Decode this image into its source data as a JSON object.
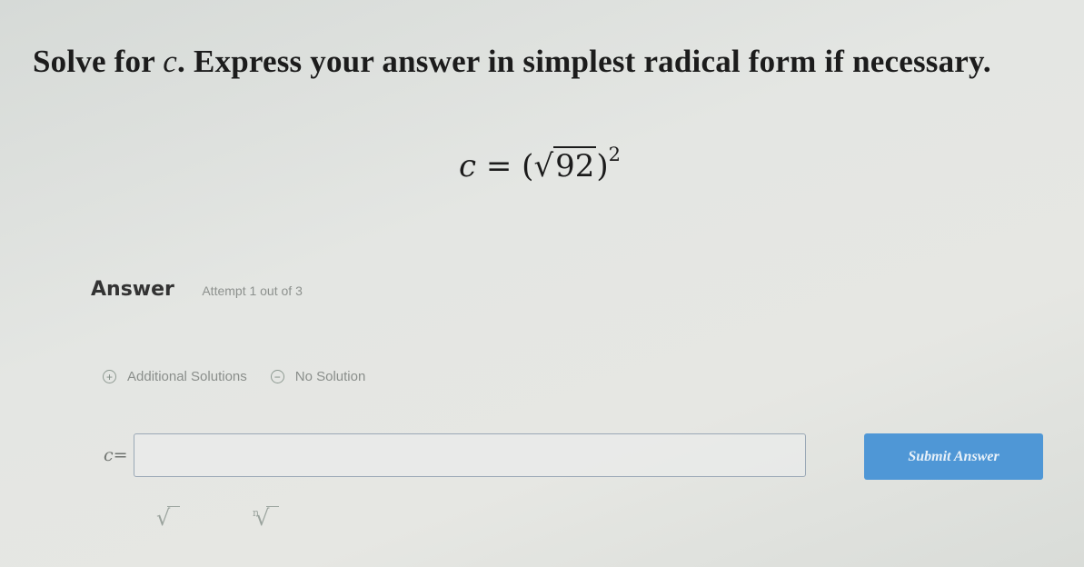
{
  "question": {
    "text_before": "Solve for ",
    "variable": "c",
    "text_after": ". Express your answer in simplest radical form if necessary."
  },
  "equation": {
    "lhs": "c",
    "equals": "=",
    "open_paren": "(",
    "radical_symbol": "√",
    "radicand": "92",
    "close_paren": ")",
    "exponent": "2"
  },
  "answer_section": {
    "label": "Answer",
    "attempt_text": "Attempt 1 out of 3"
  },
  "options": {
    "additional_solutions": {
      "icon": "+",
      "label": "Additional Solutions"
    },
    "no_solution": {
      "icon": "−",
      "label": "No Solution"
    }
  },
  "input": {
    "var": "c",
    "equals": "=",
    "value": ""
  },
  "submit_button": {
    "label": "Submit Answer"
  },
  "toolbar": {
    "sqrt_symbol": "√",
    "nth_root_index": "n",
    "nth_root_symbol": "√"
  },
  "colors": {
    "submit_background": "#4f97d6",
    "input_border": "#9aa8b6"
  }
}
